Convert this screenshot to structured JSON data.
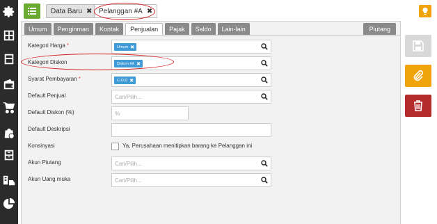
{
  "sidebar": {
    "icons": [
      "gear-icon",
      "grid-icon",
      "book-icon",
      "wallet-icon",
      "cart-icon",
      "bag-plus-icon",
      "archive-icon",
      "building-truck-icon",
      "pie-chart-icon"
    ]
  },
  "topbar": {
    "menu_icon": "list-icon",
    "tabs": [
      {
        "label": "Data Baru",
        "close": "✖"
      },
      {
        "label": "Pelanggan #A",
        "close": "✖"
      }
    ],
    "bulb_icon": "lightbulb-icon",
    "accent": "#6aaa33"
  },
  "subtabs": {
    "items": [
      "Umum",
      "Penginman",
      "Kontak",
      "Penjualan",
      "Pajak",
      "Saldo",
      "Lain-lain"
    ],
    "active": "Penjualan",
    "right": "Piutang"
  },
  "form": {
    "kategori_harga": {
      "label": "Kategori Harga",
      "required": "*",
      "tag": "Umum",
      "tag_x": "✖"
    },
    "kategori_diskon": {
      "label": "Kategori Diskon",
      "tag": "Diskon #A",
      "tag_x": "✖"
    },
    "syarat_pembayaran": {
      "label": "Syarat Pembayaran",
      "required": "*",
      "tag": "C.O.D",
      "tag_x": "✖"
    },
    "default_penjual": {
      "label": "Default Penjual",
      "placeholder": "Cari/Pilih..."
    },
    "default_diskon": {
      "label": "Default Diskon (%)",
      "placeholder": "%"
    },
    "default_deskripsi": {
      "label": "Default Deskripsi",
      "value": ""
    },
    "konsinyasi": {
      "label": "Konsinyasi",
      "checkbox_label": "Ya, Perusahaan menitipkan barang ke Pelanggan ini"
    },
    "akun_piutang": {
      "label": "Akun Piutang",
      "placeholder": "Cari/Pilih..."
    },
    "akun_uang_muka": {
      "label": "Akun Uang muka",
      "placeholder": "Cari/Pilih..."
    }
  },
  "actions": {
    "save": {
      "icon": "floppy-icon",
      "color": "#d8d8d8"
    },
    "attach": {
      "icon": "paperclip-icon",
      "color": "#f0a30a"
    },
    "delete": {
      "icon": "trash-icon",
      "color": "#b52a2a"
    }
  },
  "annotation_color": "#d42020"
}
